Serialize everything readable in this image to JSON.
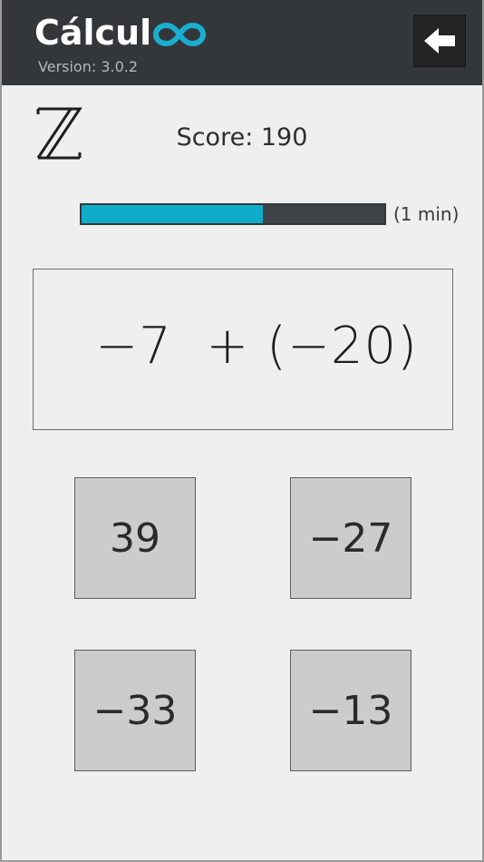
{
  "header": {
    "app_name": "Cálcul",
    "brand_color": "#1aaed0",
    "version": "Version: 3.0.2",
    "back_icon": "arrow-left-icon"
  },
  "mode": {
    "symbol": "ℤ",
    "icon": "integers-set-icon"
  },
  "score": {
    "label": "Score: 190"
  },
  "timer": {
    "progress": 0.6,
    "label": "(1 min)",
    "fill_color": "#0fadc9",
    "track_color": "#3f4246"
  },
  "question": {
    "expression": "−7  + (−20)"
  },
  "answers": [
    {
      "label": "39"
    },
    {
      "label": "−27"
    },
    {
      "label": "−33"
    },
    {
      "label": "−13"
    }
  ]
}
